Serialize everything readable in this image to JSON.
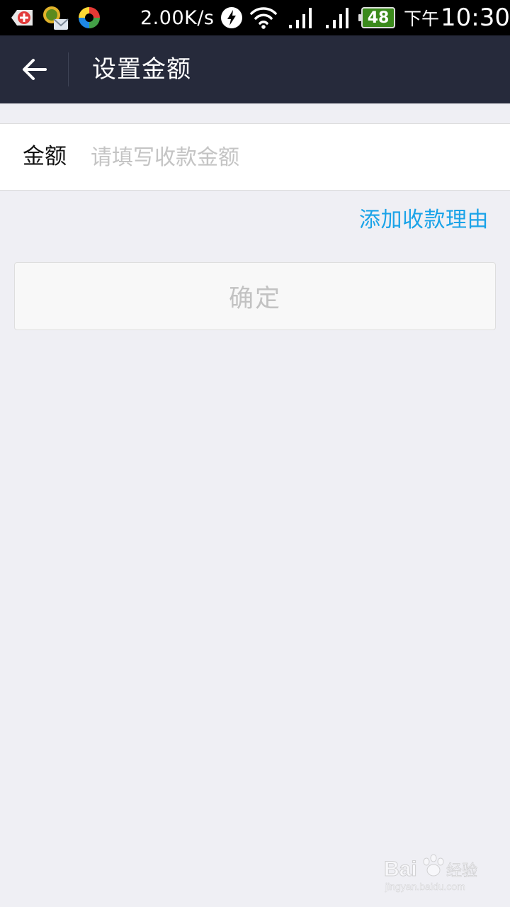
{
  "status_bar": {
    "net_speed": "2.00K/s",
    "battery": "48",
    "time_period": "下午",
    "time": "10:30",
    "icons": [
      "app-red-icon",
      "app-mail-icon",
      "app-sync-icon",
      "flash-icon",
      "wifi-icon",
      "signal-icon",
      "signal-icon"
    ]
  },
  "header": {
    "back_icon": "arrow-left-icon",
    "title": "设置金额"
  },
  "form": {
    "amount_label": "金额",
    "amount_value": "",
    "amount_placeholder": "请填写收款金额"
  },
  "add_reason_label": "添加收款理由",
  "confirm_label": "确定",
  "watermark": {
    "brand": "Bai经验",
    "url": "jingyan.baidu.com"
  },
  "colors": {
    "header_bg": "#262a3b",
    "page_bg": "#efeff4",
    "link": "#1aa3e8",
    "disabled_text": "#c2c2c2"
  }
}
